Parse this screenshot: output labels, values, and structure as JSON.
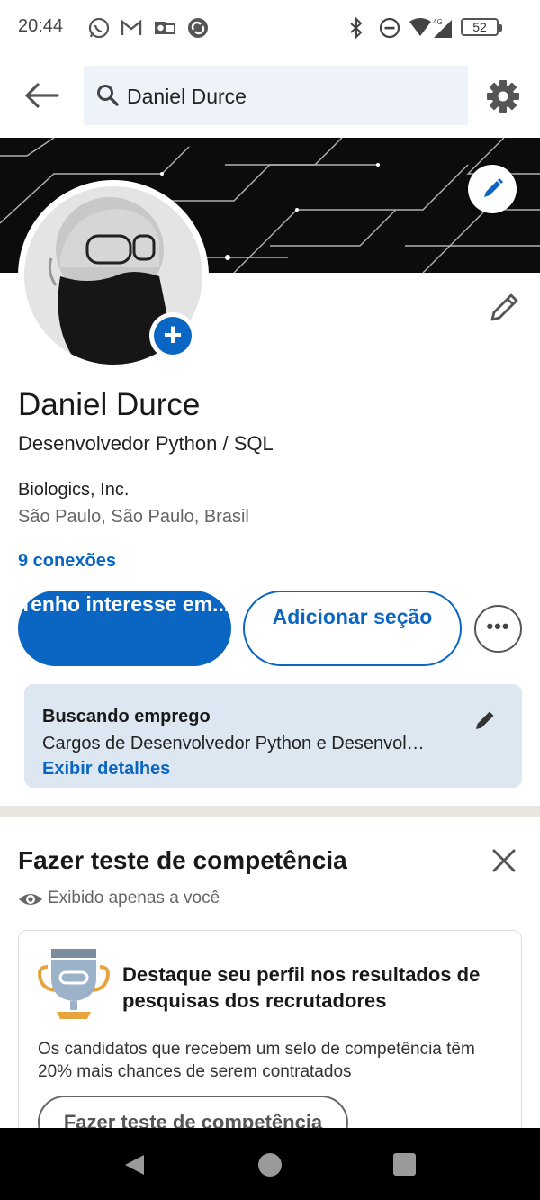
{
  "status_bar": {
    "time": "20:44",
    "icons": [
      "whatsapp-icon",
      "gmail-icon",
      "outlook-icon",
      "sync-icon",
      "bluetooth-icon",
      "dnd-icon",
      "wifi-icon",
      "signal-4g-icon"
    ],
    "network": "4G",
    "battery": "52"
  },
  "top_nav": {
    "search_value": "Daniel Durce",
    "icons": [
      "back-arrow-icon",
      "search-icon",
      "gear-icon"
    ]
  },
  "profile": {
    "name": "Daniel Durce",
    "headline": "Desenvolvedor Python / SQL",
    "company": "Biologics, Inc.",
    "location": "São Paulo, São Paulo, Brasil",
    "connections": "9 conexões"
  },
  "actions": {
    "primary_label": "Tenho interesse em...",
    "secondary_label": "Adicionar seção",
    "more_label": "•••"
  },
  "job_card": {
    "title": "Buscando emprego",
    "description": "Cargos de Desenvolvedor Python e Desenvol…",
    "link": "Exibir detalhes"
  },
  "skill_section": {
    "title": "Fazer teste de competência",
    "visibility": "Exibido apenas a você",
    "promo_title": "Destaque seu perfil nos resultados de pesquisas dos recrutadores",
    "promo_text": "Os candidatos que recebem um selo de competência têm 20% mais chances de serem contratados",
    "button_label": "Fazer teste de competência"
  },
  "colors": {
    "accent": "#0a66c2",
    "card_bg": "#dde7f1",
    "search_bg": "#edf3f8",
    "divider": "#e9e5df"
  }
}
